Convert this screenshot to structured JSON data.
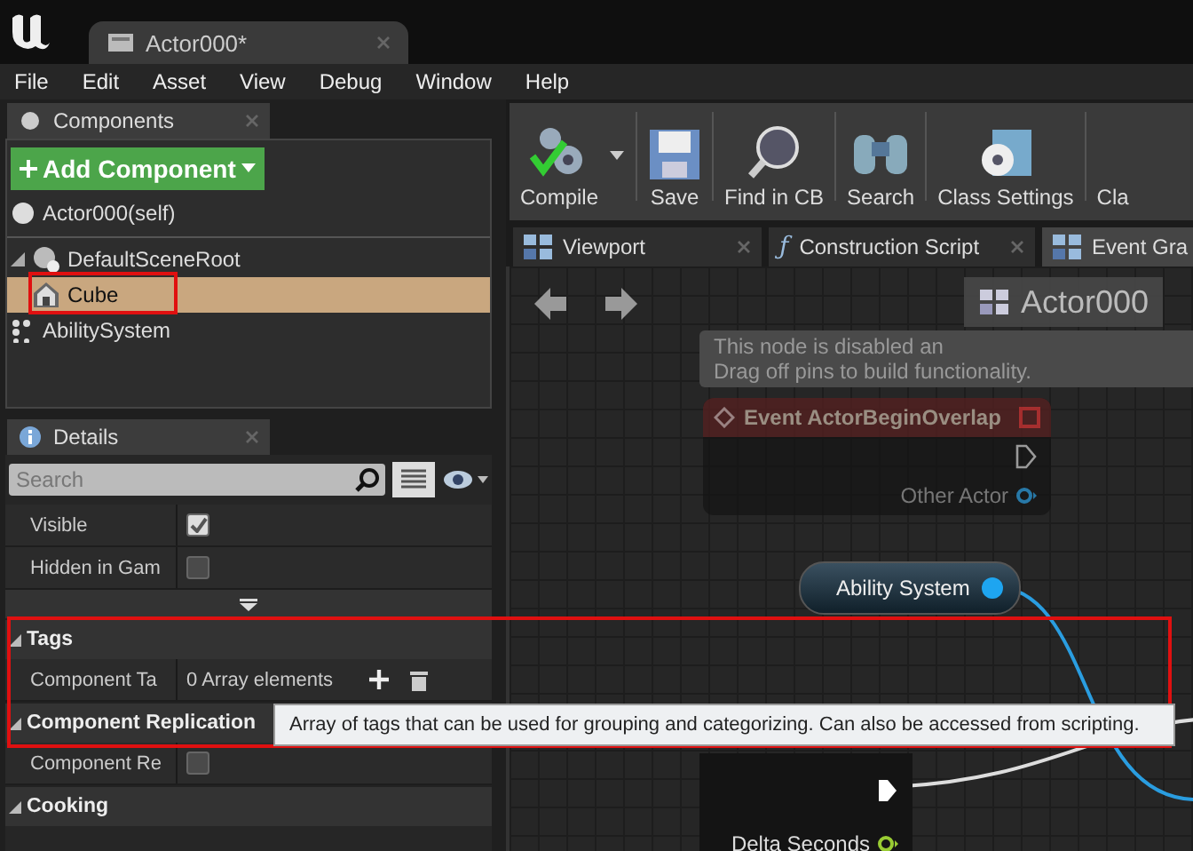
{
  "title_tab": {
    "label": "Actor000*"
  },
  "menu": [
    "File",
    "Edit",
    "Asset",
    "View",
    "Debug",
    "Window",
    "Help"
  ],
  "components": {
    "tab": "Components",
    "add_button": "Add Component",
    "tree": [
      {
        "label": "Actor000(self)",
        "kind": "actor",
        "selected": false,
        "highlighted": false
      },
      {
        "label": "DefaultSceneRoot",
        "kind": "scene",
        "selected": false,
        "highlighted": false,
        "expanded": true,
        "children": [
          {
            "label": "Cube",
            "kind": "mesh",
            "selected": true,
            "highlighted": true
          }
        ]
      },
      {
        "label": "AbilitySystem",
        "kind": "component",
        "selected": false,
        "highlighted": false
      }
    ]
  },
  "details": {
    "tab": "Details",
    "search": {
      "placeholder": "Search"
    },
    "properties": [
      {
        "label": "Visible",
        "checked": true
      },
      {
        "label": "Hidden in Gam",
        "checked": false
      }
    ],
    "sections": [
      {
        "title": "Tags",
        "expanded": true,
        "rows": [
          {
            "kind": "array",
            "label": "Component Ta",
            "value": "0 Array elements"
          }
        ]
      },
      {
        "title": "Component Replication",
        "expanded": true,
        "rows": [
          {
            "kind": "check",
            "label": "Component Re",
            "checked": false
          }
        ]
      },
      {
        "title": "Cooking",
        "expanded": true
      }
    ]
  },
  "toolbar": [
    {
      "label": "Compile",
      "kind": "compile",
      "dropdown": true
    },
    {
      "label": "Save",
      "kind": "save",
      "dropdown": false
    },
    {
      "label": "Find in CB",
      "kind": "find",
      "dropdown": false
    },
    {
      "label": "Search",
      "kind": "search",
      "dropdown": false
    },
    {
      "label": "Class Settings",
      "kind": "settings",
      "dropdown": false
    },
    {
      "label": "Cla",
      "kind": "partial",
      "dropdown": false
    }
  ],
  "graph_tabs": [
    {
      "label": "Viewport",
      "kind": "viewport",
      "selected": false
    },
    {
      "label": "Construction Script",
      "kind": "function",
      "icon": "ƒ",
      "selected": false
    },
    {
      "label": "Event Gra",
      "kind": "graph",
      "selected": true
    }
  ],
  "graph": {
    "breadcrumb": "Actor000",
    "notice": [
      "This node is disabled an",
      "Drag off pins to build functionality."
    ],
    "event_node": {
      "title": "Event ActorBeginOverlap",
      "disabled": true,
      "pin": "Other Actor"
    },
    "variable_node": {
      "label": "Ability System"
    },
    "tick_node": {
      "pin": "Delta Seconds"
    }
  },
  "tooltip": "Array of tags that can be used for grouping and categorizing. Can also be accessed from scripting."
}
